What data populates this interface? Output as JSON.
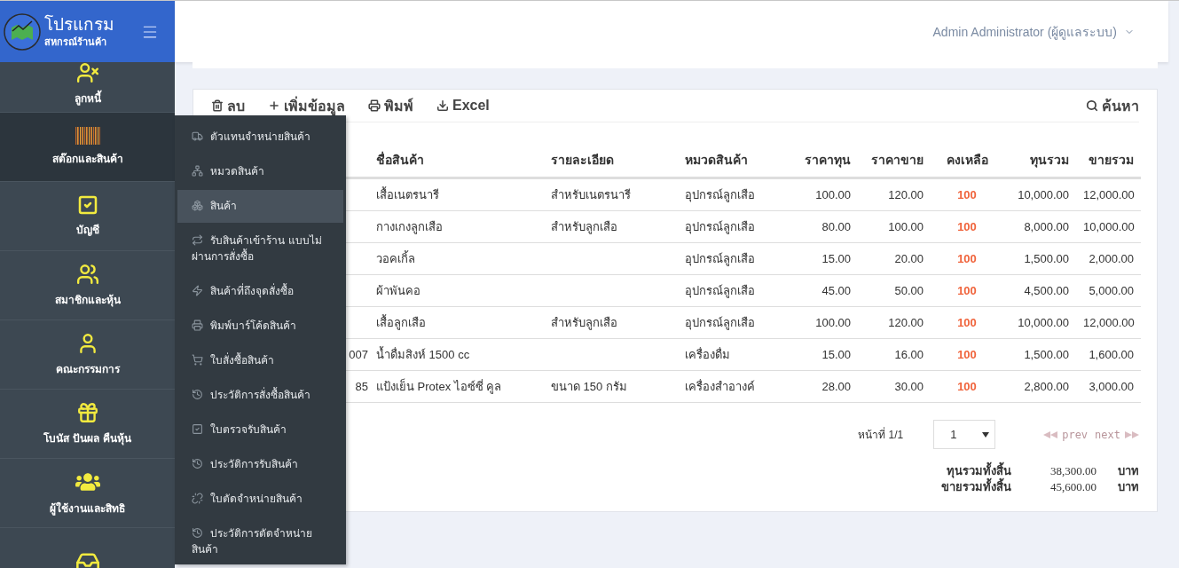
{
  "brand": {
    "title": "โปรแกรม",
    "subtitle": "สหกรณ์ร้านค้า"
  },
  "user_menu": {
    "label": "Admin Administrator (ผู้ดูแลระบบ)"
  },
  "sidebar": {
    "items": [
      {
        "label": "ลูกหนี้",
        "selected": false
      },
      {
        "label": "สต๊อกและสินค้า",
        "selected": true
      },
      {
        "label": "บัญชี",
        "selected": false
      },
      {
        "label": "สมาชิกและหุ้น",
        "selected": false
      },
      {
        "label": "คณะกรรมการ",
        "selected": false
      },
      {
        "label": "โบนัส ปันผล คืนหุ้น",
        "selected": false
      },
      {
        "label": "ผู้ใช้งานและสิทธิ",
        "selected": false
      },
      {
        "selected": false
      }
    ]
  },
  "submenu": {
    "items": [
      {
        "label": "ตัวแทนจำหน่ายสินค้า",
        "hovered": false
      },
      {
        "label": "หมวดสินค้า",
        "hovered": false
      },
      {
        "label": "สินค้า",
        "hovered": true
      },
      {
        "label": "รับสินค้าเข้าร้าน แบบไม่ผ่านการสั่งซื้อ",
        "hovered": false
      },
      {
        "label": "สินค้าที่ถึงจุดสั่งซื้อ",
        "hovered": false
      },
      {
        "label": "พิมพ์บาร์โค้ดสินค้า",
        "hovered": false
      },
      {
        "label": "ใบสั่งซื้อสินค้า",
        "hovered": false
      },
      {
        "label": "ประวัติการสั่งซื้อสินค้า",
        "hovered": false
      },
      {
        "label": "ใบตรวจรับสินค้า",
        "hovered": false
      },
      {
        "label": "ประวัติการรับสินค้า",
        "hovered": false
      },
      {
        "label": "ใบตัดจำหน่ายสินค้า",
        "hovered": false
      },
      {
        "label": "ประวัติการตัดจำหน่ายสินค้า",
        "hovered": false
      }
    ]
  },
  "toolbar": {
    "actions": [
      {
        "label": "ลบ"
      },
      {
        "label": "เพิ่มข้อมูล"
      },
      {
        "label": "พิมพ์"
      },
      {
        "label": "Excel"
      }
    ],
    "search": {
      "label": "ค้นหา"
    }
  },
  "table": {
    "columns": [
      "ชื่อสินค้า",
      "รายละเอียด",
      "หมวดสินค้า",
      "ราคาทุน",
      "ราคาขาย",
      "คงเหลือ",
      "ทุนรวม",
      "ขายรวม"
    ],
    "rows": [
      {
        "name": "เสื้อเนตรนารี",
        "detail": "สำหรับเนตรนารี",
        "category": "อุปกรณ์ลูกเสือ",
        "cost": "100.00",
        "price": "120.00",
        "stock": "100",
        "cost_total": "10,000.00",
        "sale_total": "12,000.00"
      },
      {
        "name": "กางเกงลูกเสือ",
        "detail": "สำหรับลูกเสือ",
        "category": "อุปกรณ์ลูกเสือ",
        "cost": "80.00",
        "price": "100.00",
        "stock": "100",
        "cost_total": "8,000.00",
        "sale_total": "10,000.00"
      },
      {
        "name": "วอคเกิ้ล",
        "category": "อุปกรณ์ลูกเสือ",
        "cost": "15.00",
        "price": "20.00",
        "stock": "100",
        "cost_total": "1,500.00",
        "sale_total": "2,000.00"
      },
      {
        "name": "ผ้าพันคอ",
        "category": "อุปกรณ์ลูกเสือ",
        "cost": "45.00",
        "price": "50.00",
        "stock": "100",
        "cost_total": "4,500.00",
        "sale_total": "5,000.00"
      },
      {
        "name": "เสื้อลูกเสือ",
        "detail": "สำหรับลูกเสือ",
        "category": "อุปกรณ์ลูกเสือ",
        "cost": "100.00",
        "price": "120.00",
        "stock": "100",
        "cost_total": "10,000.00",
        "sale_total": "12,000.00"
      },
      {
        "column_1": "007",
        "name": "น้ำดื่มสิงห์ 1500 cc",
        "category": "เครื่องดื่ม",
        "cost": "15.00",
        "price": "16.00",
        "stock": "100",
        "cost_total": "1,500.00",
        "sale_total": "1,600.00"
      },
      {
        "column_1": "85",
        "name": "แป้งเย็น Protex ไอซ์ซี่ คูล",
        "detail": "ขนาด 150 กรัม",
        "category": "เครื่องสำอางค์",
        "cost": "28.00",
        "price": "30.00",
        "stock": "100",
        "cost_total": "2,800.00",
        "sale_total": "3,000.00"
      }
    ]
  },
  "pagination": {
    "page_label": "หน้าที่ 1/1",
    "page_select": "1",
    "prev": {
      "label": "prev",
      "disabled": true
    },
    "next": {
      "label": "next",
      "disabled": true
    }
  },
  "totals": [
    {
      "label": "ทุนรวมทั้งสิ้น",
      "value": "38,300.00",
      "unit": "บาท"
    },
    {
      "label": "ขายรวมทั้งสิ้น",
      "value": "45,600.00",
      "unit": "บาท"
    }
  ]
}
